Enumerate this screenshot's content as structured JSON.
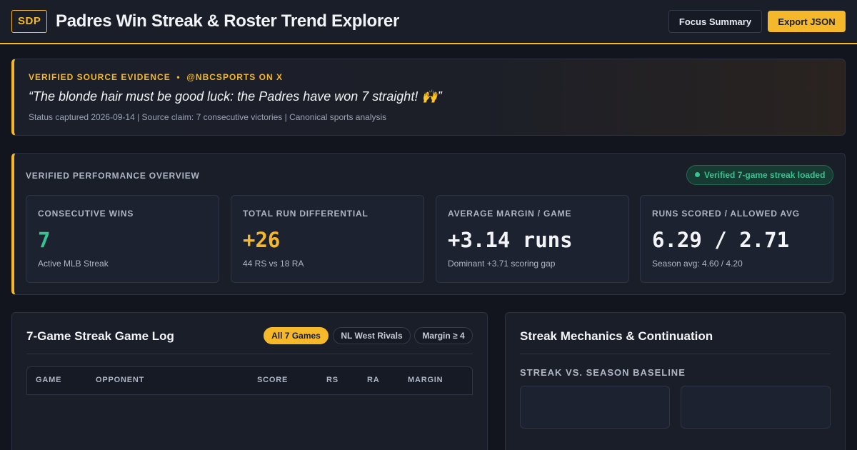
{
  "header": {
    "logo": "SDP",
    "title": "Padres Win Streak & Roster Trend Explorer",
    "focus_label": "Focus Summary",
    "export_label": "Export JSON"
  },
  "evidence": {
    "label": "VERIFIED SOURCE EVIDENCE  •  @NBCSPORTS ON X",
    "quote": "“The blonde hair must be good luck: the Padres have won 7 straight! 🙌”",
    "meta": "Status captured 2026-09-14 | Source claim: 7 consecutive victories | Canonical sports analysis"
  },
  "overview": {
    "title": "VERIFIED PERFORMANCE OVERVIEW",
    "badge": "Verified 7-game streak loaded",
    "cards": [
      {
        "label": "CONSECUTIVE WINS",
        "value": "7",
        "sub": "Active MLB Streak",
        "color": "#35c48f"
      },
      {
        "label": "TOTAL RUN DIFFERENTIAL",
        "value": "+26",
        "sub": "44 RS vs 18 RA",
        "color": "#f5b82a"
      },
      {
        "label": "AVERAGE MARGIN / GAME",
        "value": "+3.14 runs",
        "sub": "Dominant +3.71 scoring gap",
        "color": "#f3f4f7"
      },
      {
        "label": "RUNS SCORED / ALLOWED AVG",
        "value": "6.29 / 2.71",
        "sub": "Season avg: 4.60 / 4.20",
        "color": "#f3f4f7"
      }
    ]
  },
  "gamelog": {
    "title": "7-Game Streak Game Log",
    "filters": [
      "All 7 Games",
      "NL West Rivals",
      "Margin ≥ 4"
    ],
    "columns": [
      "GAME",
      "OPPONENT",
      "SCORE",
      "RS",
      "RA",
      "MARGIN"
    ]
  },
  "mechanics": {
    "title": "Streak Mechanics & Continuation",
    "subtitle": "STREAK VS. SEASON BASELINE"
  },
  "colors": {
    "accent": "#f5b82a",
    "success": "#35c48f",
    "background": "#12151d"
  }
}
